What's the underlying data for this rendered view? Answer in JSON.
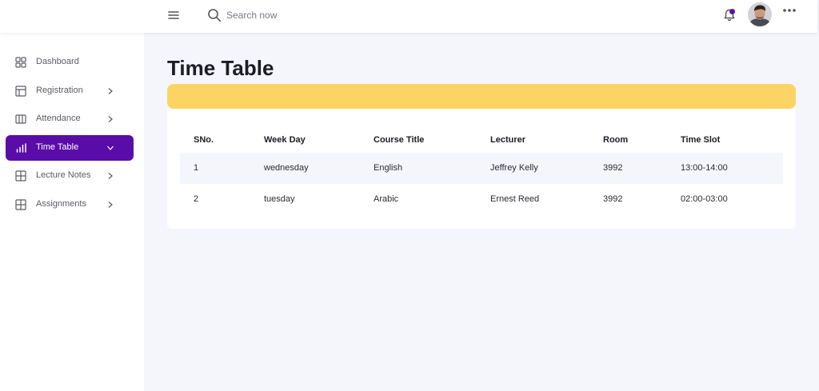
{
  "search": {
    "placeholder": "Search now",
    "value": ""
  },
  "colors": {
    "accent": "#5a0ca8",
    "banner": "#fdd463",
    "notification_dot": "#5a189a"
  },
  "sidebar": {
    "items": [
      {
        "label": "Dashboard",
        "icon": "grid-icon",
        "has_chevron": false,
        "active": false
      },
      {
        "label": "Registration",
        "icon": "layout-icon",
        "has_chevron": true,
        "active": false
      },
      {
        "label": "Attendance",
        "icon": "columns-icon",
        "has_chevron": true,
        "active": false
      },
      {
        "label": "Time Table",
        "icon": "bar-chart-icon",
        "has_chevron": true,
        "active": true
      },
      {
        "label": "Lecture Notes",
        "icon": "table-icon",
        "has_chevron": true,
        "active": false
      },
      {
        "label": "Assignments",
        "icon": "table-icon",
        "has_chevron": true,
        "active": false
      }
    ]
  },
  "main": {
    "title": "Time Table",
    "table": {
      "columns": [
        "SNo.",
        "Week Day",
        "Course Title",
        "Lecturer",
        "Room",
        "Time Slot"
      ],
      "rows": [
        [
          "1",
          "wednesday",
          "English",
          "Jeffrey Kelly",
          "3992",
          "13:00-14:00"
        ],
        [
          "2",
          "tuesday",
          "Arabic",
          "Ernest Reed",
          "3992",
          "02:00-03:00"
        ]
      ]
    }
  }
}
